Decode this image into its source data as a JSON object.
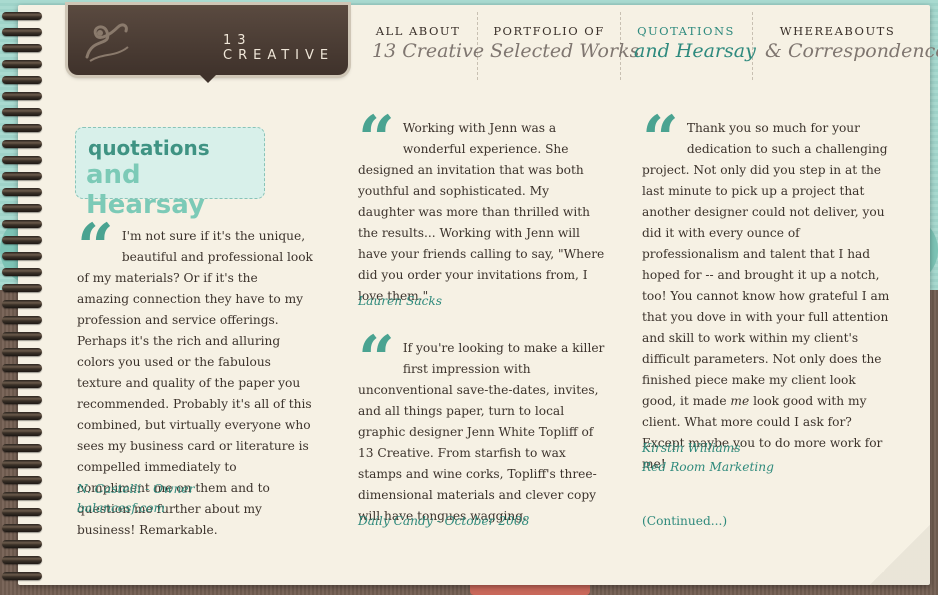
{
  "brand": {
    "logo_text": "13 CREATIVE"
  },
  "nav": [
    {
      "top": "ALL ABOUT",
      "bottom": "13 Creative"
    },
    {
      "top": "PORTFOLIO OF",
      "bottom": "Selected Works"
    },
    {
      "top": "QUOTATIONS",
      "bottom": "and Hearsay"
    },
    {
      "top": "WHEREABOUTS",
      "bottom": "& Correspondence"
    }
  ],
  "section": {
    "title_a": "quotations",
    "title_b": "and Hearsay"
  },
  "quotes": [
    {
      "text": "I'm not sure if it's the unique, beautiful and professional look of my materials? Or if it's the amazing connection they have to my profession and service offerings. Perhaps it's the rich and alluring colors you used or the fabulous texture and quality of the paper you recommended. Probably it's all of this combined, but virtually everyone who sees my business card or literature is compelled immediately to compliment me on them and to question me further about my business! Remarkable.",
      "author": "N. Castelli - Owner",
      "org": "balancesf.com"
    },
    {
      "text": "Working with Jenn was a wonderful experience. She designed an invitation that was both youthful and sophisticated. My daughter was more than thrilled with the results... Working with Jenn will have your friends calling to say, \"Where did you order your invitations from, I love them.\"",
      "author": "Lauren Sacks"
    },
    {
      "text": "If you're looking to make a killer first impression with unconventional save-the-dates, invites, and all things paper, turn to local graphic designer Jenn White Topliff of 13 Creative. From starfish to wax stamps and wine corks, Topliff's three-dimensional materials and clever copy will have tongues wagging.",
      "author": "Daily Candy - October 2008"
    },
    {
      "text_pre": "Thank you so much for your dedication to such a challenging project. Not only did you step in at the last minute to pick up a project that another designer could not deliver, you did it with every ounce of professionalism and talent that I had hoped for -- and brought it up a notch, too! You cannot know how grateful I am that you dove in with your full attention and skill to work within my client's difficult parameters. Not only does the finished piece make my client look good, it made ",
      "text_em": "me",
      "text_post": " look good with my client. What more could I ask for? Except maybe you to do more work for me!",
      "author": "Kirstin Williams",
      "org": "Red Room Marketing"
    }
  ],
  "continued": "(Continued...)"
}
